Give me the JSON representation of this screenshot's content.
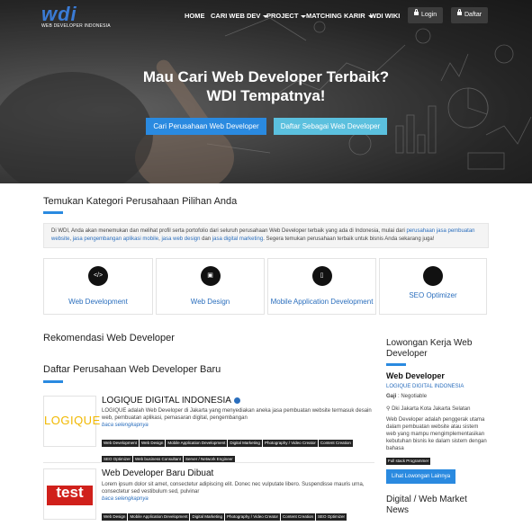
{
  "nav": {
    "logo_text": "wdi",
    "logo_sub": "WEB DEVELOPER INDONESIA",
    "items": [
      {
        "label": "HOME",
        "dropdown": false
      },
      {
        "label": "CARI WEB DEV",
        "dropdown": true
      },
      {
        "label": "PROJECT",
        "dropdown": true
      },
      {
        "label": "MATCHING KARIR",
        "dropdown": true
      },
      {
        "label": "WDI WIKI",
        "dropdown": false
      }
    ],
    "login": "Login",
    "register": "Daftar"
  },
  "hero": {
    "title_line1": "Mau Cari Web Developer Terbaik?",
    "title_line2": "WDI Tempatnya!",
    "cta_primary": "Cari Perusahaan Web Developer",
    "cta_secondary": "Daftar Sebagai Web Developer"
  },
  "categories_section": {
    "title": "Temukan Kategori Perusahaan Pilihan Anda",
    "intro_1": "Di WDI, Anda akan menemukan dan melihat profil serta portofolio dari seluruh perusahaan Web Developer terbaik yang ada di Indonesia, mulai dari ",
    "intro_link1": "perusahaan jasa pembuatan website",
    "intro_2": ", ",
    "intro_link2": "jasa pengembangan aplikasi mobile",
    "intro_3": ", ",
    "intro_link3": "jasa web design",
    "intro_4": " dan ",
    "intro_link4": "jasa digital marketing",
    "intro_5": ". Segera temukan perusahaan terbaik untuk bisnis Anda sekarang juga!",
    "items": [
      {
        "label": "Web Development",
        "icon": "</>"
      },
      {
        "label": "Web Design",
        "icon": "▣"
      },
      {
        "label": "Mobile Application Development",
        "icon": "▯"
      },
      {
        "label": "SEO Optimizer",
        "icon": ""
      }
    ]
  },
  "recommend_title": "Rekomendasi Web Developer",
  "list_title": "Daftar Perusahaan Web Developer Baru",
  "companies": [
    {
      "logo_text": "LOGIQUE",
      "name": "LOGIQUE DIGITAL INDONESIA",
      "desc": "LOGIQUE adalah Web Developer di Jakarta yang menyediakan aneka jasa pembuatan website termasuk desain web, pembuatan aplikasi, pemasaran digital, pengembangan",
      "more": "baca selengkapnya",
      "tags": [
        "Web Development",
        "Web Design",
        "Mobile Application Development",
        "Digital Marketing",
        "Photography / Video Creator",
        "Content Creation",
        "SEO Optimizer",
        "Web business Consultant",
        "Server / Network Engineer"
      ]
    },
    {
      "logo_text": "test",
      "name": "Web Developer Baru Dibuat",
      "desc": "Lorem ipsum dolor sit amet, consectetur adipiscing elit. Donec nec vulputate libero. Suspendisse mauris urna, consectetur sed vestibulum sed, pulvinar",
      "more": "baca selengkapnya",
      "tags": [
        "Web Design",
        "Mobile Application Development",
        "Digital Marketing",
        "Photography / Video Creator",
        "Content Creation",
        "SEO Optimizer"
      ]
    }
  ],
  "sidebar": {
    "jobs_title": "Lowongan Kerja Web Developer",
    "job_title": "Web Developer",
    "job_company": "LOGIQUE DIGITAL INDONESIA",
    "salary_label": "Gaji",
    "salary_value": ": Negotiable",
    "location": "Dki Jakarta Kota Jakarta Selatan",
    "job_desc": "Web Developer adalah penggerak utama dalam pembuatan website atau sistem web yang mampu mengimplementasikan kebutuhan bisnis ke dalam sistem dengan bahasa",
    "job_tag": "Full stack Programmer",
    "more_button": "Lihat Lowongan Lainnya",
    "news_title": "Digital / Web Market News"
  },
  "colors": {
    "accent": "#2a8ae0",
    "primary_btn": "#2a8ae0",
    "secondary_btn": "#5bc0de",
    "link": "#2a6ebd"
  }
}
